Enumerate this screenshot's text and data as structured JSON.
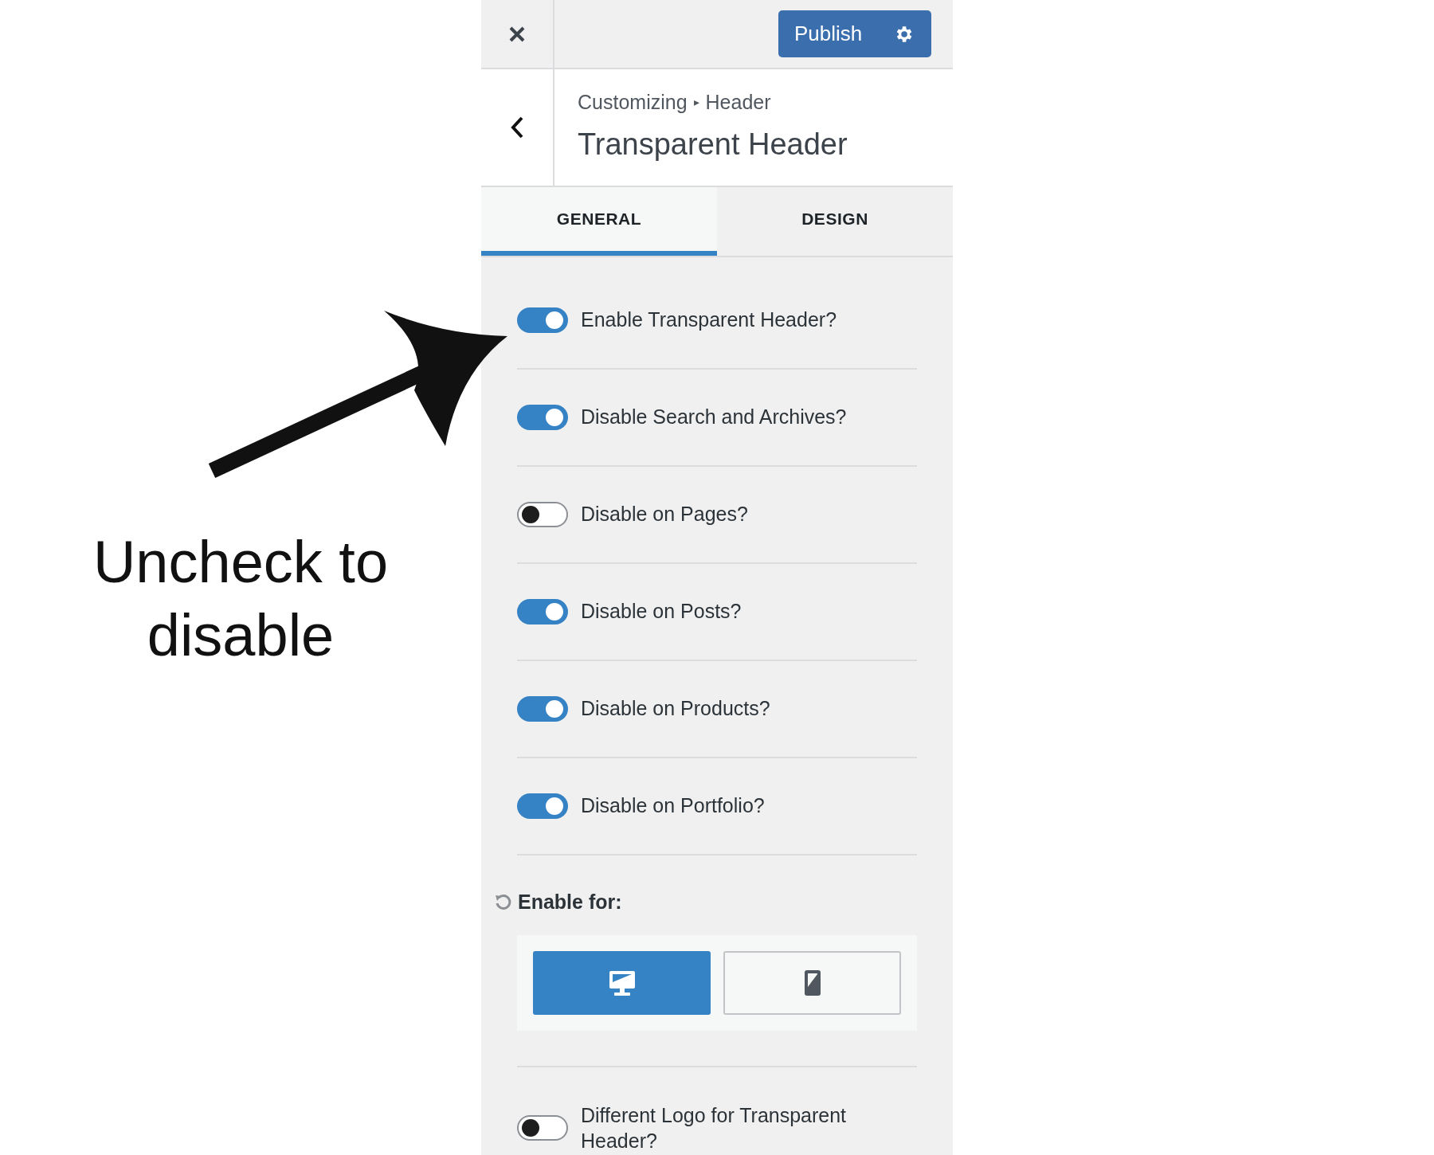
{
  "annotation": {
    "text": "Uncheck to disable"
  },
  "topbar": {
    "publish": "Publish"
  },
  "header": {
    "breadcrumb_parent": "Customizing",
    "breadcrumb_separator": "▸",
    "breadcrumb_current": "Header",
    "title": "Transparent Header"
  },
  "tabs": [
    {
      "label": "GENERAL",
      "selected": true
    },
    {
      "label": "DESIGN",
      "selected": false
    }
  ],
  "toggles": [
    {
      "label": "Enable Transparent Header?",
      "on": true
    },
    {
      "label": "Disable Search and Archives?",
      "on": true
    },
    {
      "label": "Disable on Pages?",
      "on": false
    },
    {
      "label": "Disable on Posts?",
      "on": true
    },
    {
      "label": "Disable on Products?",
      "on": true
    },
    {
      "label": "Disable on Portfolio?",
      "on": true
    }
  ],
  "enable_for": {
    "label": "Enable for:",
    "devices": [
      {
        "kind": "desktop",
        "selected": true
      },
      {
        "kind": "mobile",
        "selected": false
      }
    ]
  },
  "last_toggle": {
    "label": "Different Logo for Transparent Header?",
    "on": false
  }
}
